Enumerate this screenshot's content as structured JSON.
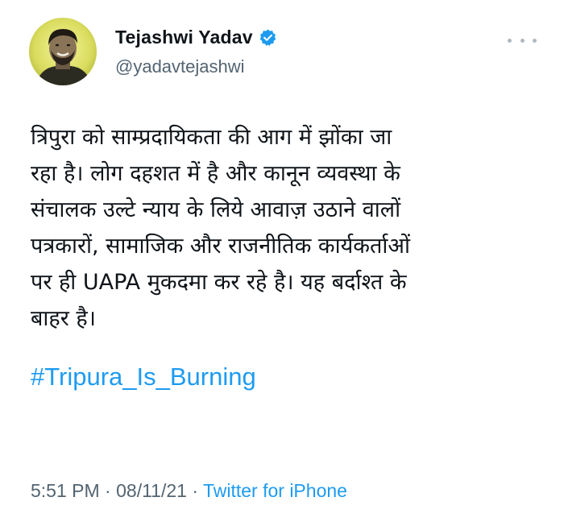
{
  "user": {
    "name": "Tejashwi Yadav",
    "handle": "@yadavtejashwi",
    "verified": true,
    "avatar_icon": "profile-photo"
  },
  "more_icon": "more-options-icon",
  "tweet": {
    "lines": [
      "त्रिपुरा को साम्प्रदायिकता की आग में झोंका जा",
      "रहा है। लोग दहशत में है और कानून व्यवस्था के",
      "संचालक उल्टे न्याय के लिये आवाज़ उठाने वालों",
      "पत्रकारों, सामाजिक और राजनीतिक कार्यकर्ताओं",
      "पर ही UAPA मुकदमा कर रहे है। यह बर्दाश्त के",
      "बाहर है।"
    ],
    "hashtag": "#Tripura_Is_Burning"
  },
  "meta": {
    "time": "5:51 PM",
    "separator1": " · ",
    "date": "08/11/21",
    "separator2": " · ",
    "source": "Twitter for iPhone"
  },
  "colors": {
    "text": "#0f1419",
    "secondary": "#536471",
    "link": "#1d9bf0",
    "verified": "#1d9bf0",
    "avatar_bg": "#e3e66a"
  }
}
